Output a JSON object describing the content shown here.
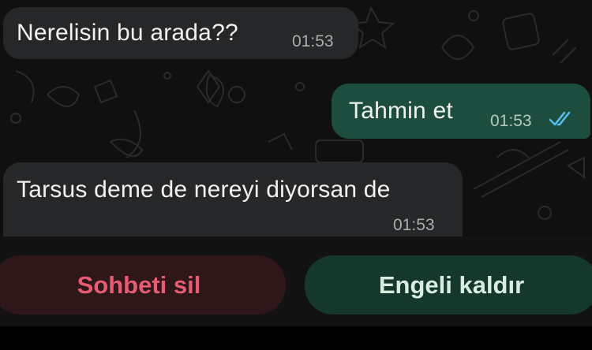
{
  "messages": [
    {
      "direction": "incoming",
      "text": "Nerelisin bu arada??",
      "time": "01:53"
    },
    {
      "direction": "outgoing",
      "text": "Tahmin et",
      "time": "01:53",
      "status": "read"
    },
    {
      "direction": "incoming",
      "text": "Tarsus deme de nereyi diyorsan de",
      "time": "01:53"
    }
  ],
  "actions": {
    "delete_chat": "Sohbeti sil",
    "unblock": "Engeli kaldır"
  },
  "colors": {
    "incoming_bubble": "#262728",
    "outgoing_bubble": "#1d4d3f",
    "read_ticks": "#53bdeb",
    "delete_text": "#e85c73",
    "unblock_text": "#d9ecdf"
  },
  "icons": {
    "read_receipt": "double-check-icon"
  }
}
